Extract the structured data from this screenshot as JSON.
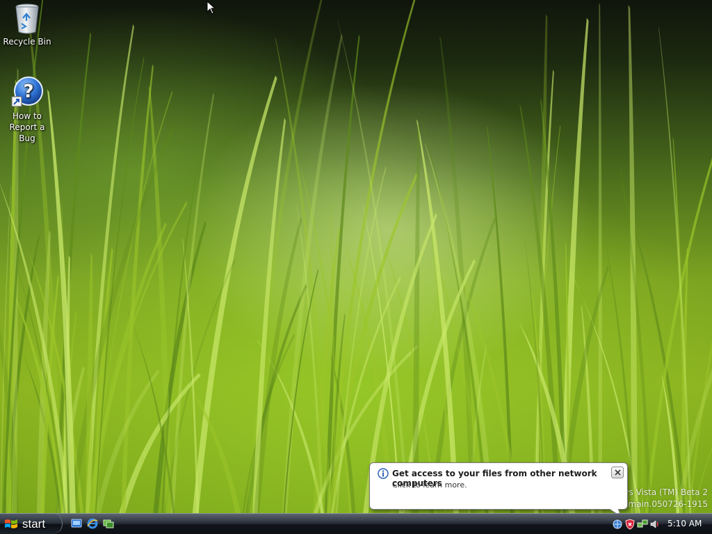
{
  "desktop": {
    "icons": [
      {
        "label": "Recycle Bin",
        "icon": "recycle-bin-icon"
      },
      {
        "label": "How to\nReport a Bug",
        "icon": "help-icon"
      }
    ],
    "watermark": {
      "line1": "dows Vista (TM) Beta 2",
      "line2": "winmain.050726-1915"
    }
  },
  "balloon": {
    "icon": "info-icon",
    "title": "Get access to your files from other network computers",
    "text": "Click to learn more.",
    "close_icon": "close-icon"
  },
  "taskbar": {
    "start_label": "start",
    "quick_launch": [
      "show-desktop-icon",
      "internet-explorer-icon",
      "switch-windows-icon"
    ],
    "tray_icons": [
      "network-icon",
      "security-center-icon",
      "network-connections-icon",
      "volume-icon"
    ],
    "clock": "5:10 AM"
  },
  "colors": {
    "taskbar": "#1b2028",
    "grass": "#8cb320",
    "help_icon": "#2a6fd1"
  }
}
